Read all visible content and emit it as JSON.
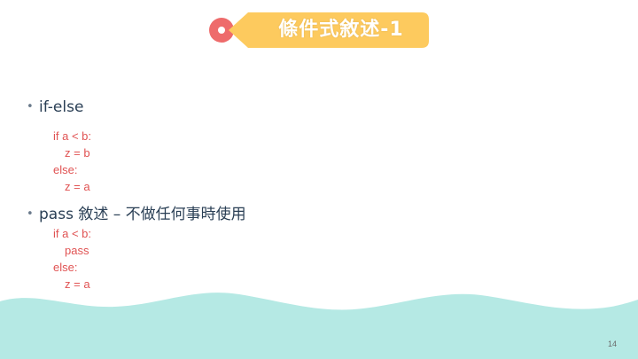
{
  "slide": {
    "title": "條件式敘述-1",
    "bullets": [
      {
        "label": "if-else",
        "code": [
          "if a < b:",
          "z = b",
          "else:",
          "z = a"
        ]
      },
      {
        "label": "pass 敘述 – 不做任何事時使用",
        "code": [
          "if a < b:",
          "pass",
          "else:",
          "z = a"
        ]
      }
    ],
    "page_number": "14"
  },
  "colors": {
    "tag_fill": "#fdca5e",
    "tag_dot": "#ee6b6b",
    "code_text": "#e05353",
    "bullet_text": "#2a3f55",
    "wave": "#b5e9e4"
  }
}
